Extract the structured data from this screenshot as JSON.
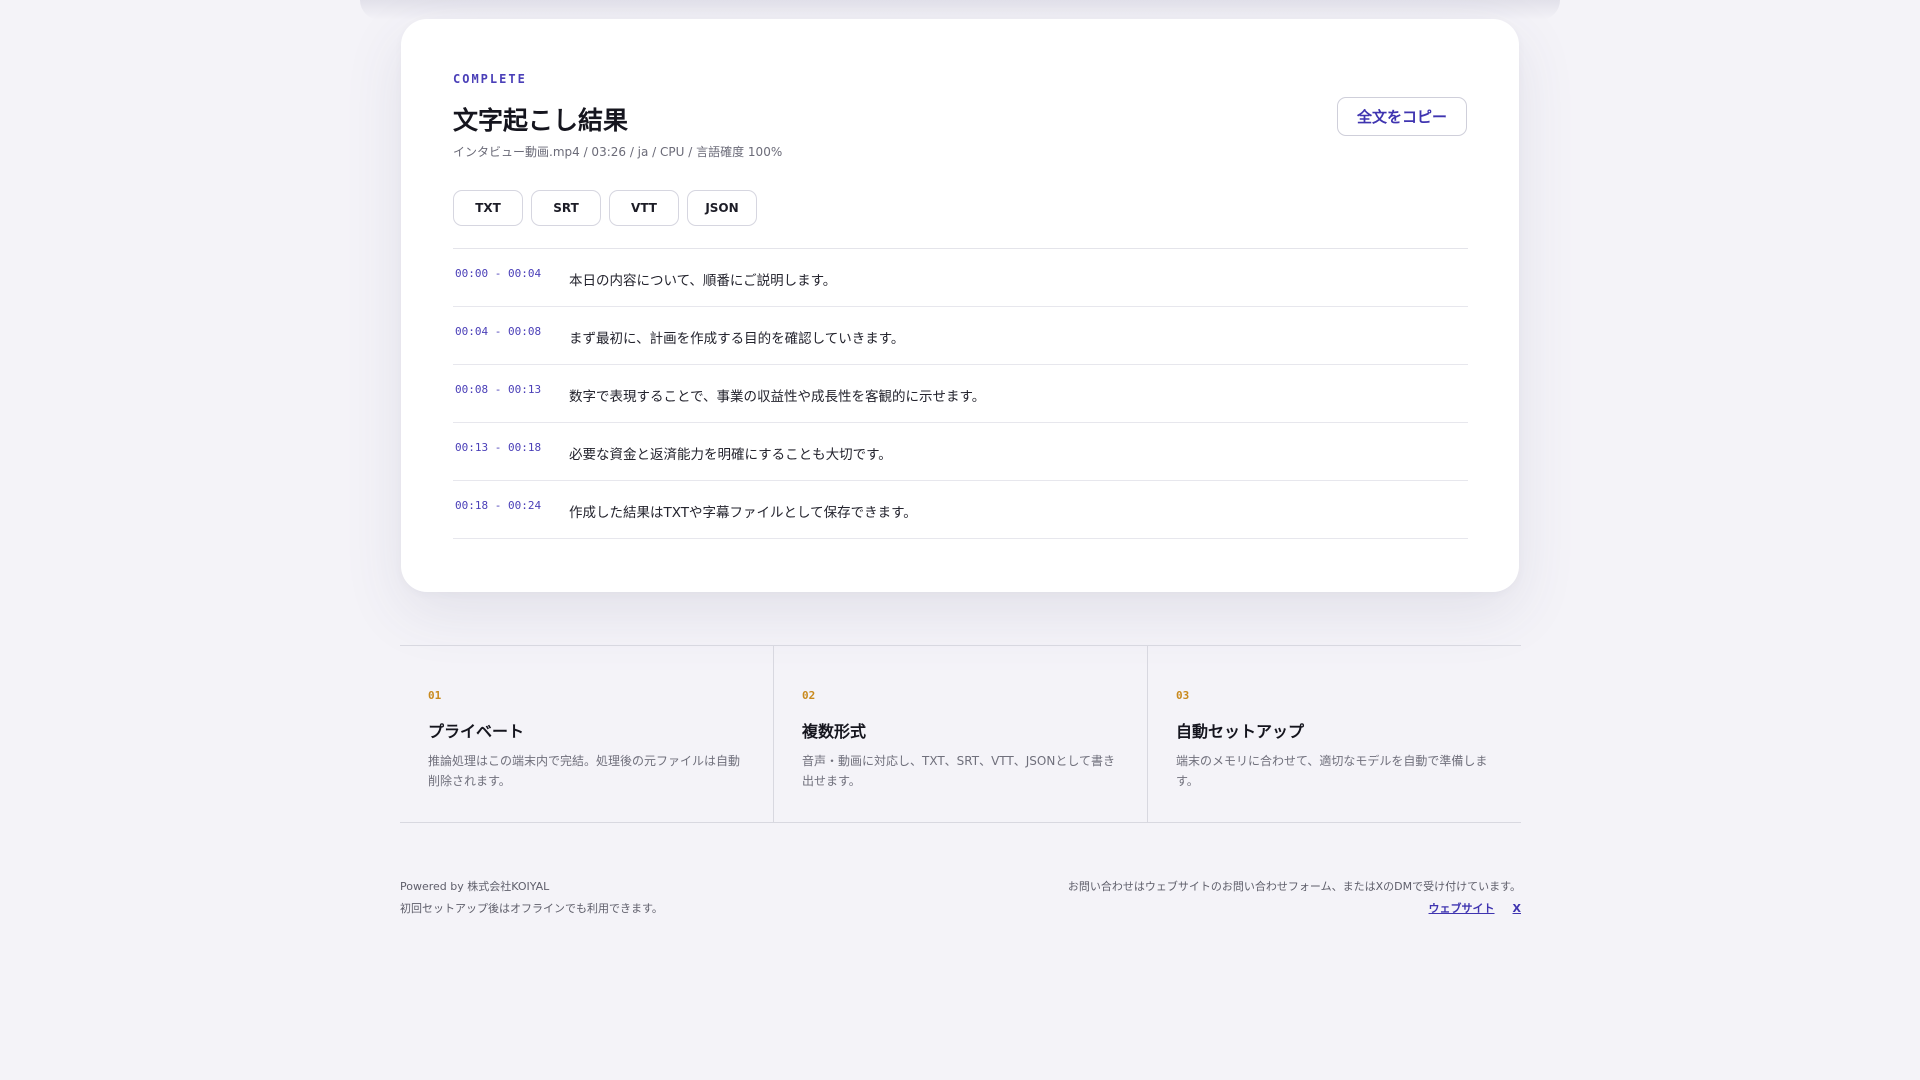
{
  "result": {
    "status": "COMPLETE",
    "title": "文字起こし結果",
    "meta": "インタビュー動画.mp4 / 03:26 / ja / CPU / 言語確度 100%",
    "copy_label": "全文をコピー",
    "formats": [
      "TXT",
      "SRT",
      "VTT",
      "JSON"
    ],
    "segments": [
      {
        "time": "00:00 - 00:04",
        "text": "本日の内容について、順番にご説明します。"
      },
      {
        "time": "00:04 - 00:08",
        "text": "まず最初に、計画を作成する目的を確認していきます。"
      },
      {
        "time": "00:08 - 00:13",
        "text": "数字で表現することで、事業の収益性や成長性を客観的に示せます。"
      },
      {
        "time": "00:13 - 00:18",
        "text": "必要な資金と返済能力を明確にすることも大切です。"
      },
      {
        "time": "00:18 - 00:24",
        "text": "作成した結果はTXTや字幕ファイルとして保存できます。"
      }
    ]
  },
  "features": [
    {
      "num": "01",
      "title": "プライベート",
      "desc": "推論処理はこの端末内で完結。処理後の元ファイルは自動削除されます。"
    },
    {
      "num": "02",
      "title": "複数形式",
      "desc": "音声・動画に対応し、TXT、SRT、VTT、JSONとして書き出せます。"
    },
    {
      "num": "03",
      "title": "自動セットアップ",
      "desc": "端末のメモリに合わせて、適切なモデルを自動で準備します。"
    }
  ],
  "footer": {
    "powered": "Powered by 株式会社KOIYAL",
    "offline": "初回セットアップ後はオフラインでも利用できます。",
    "contact": "お問い合わせはウェブサイトのお問い合わせフォーム、またはXのDMで受け付けています。",
    "link_website": "ウェブサイト",
    "link_x": "X"
  },
  "colors": {
    "accent": "#3f34b0",
    "number_accent": "#c98a1e",
    "background": "#f4f3f8"
  }
}
